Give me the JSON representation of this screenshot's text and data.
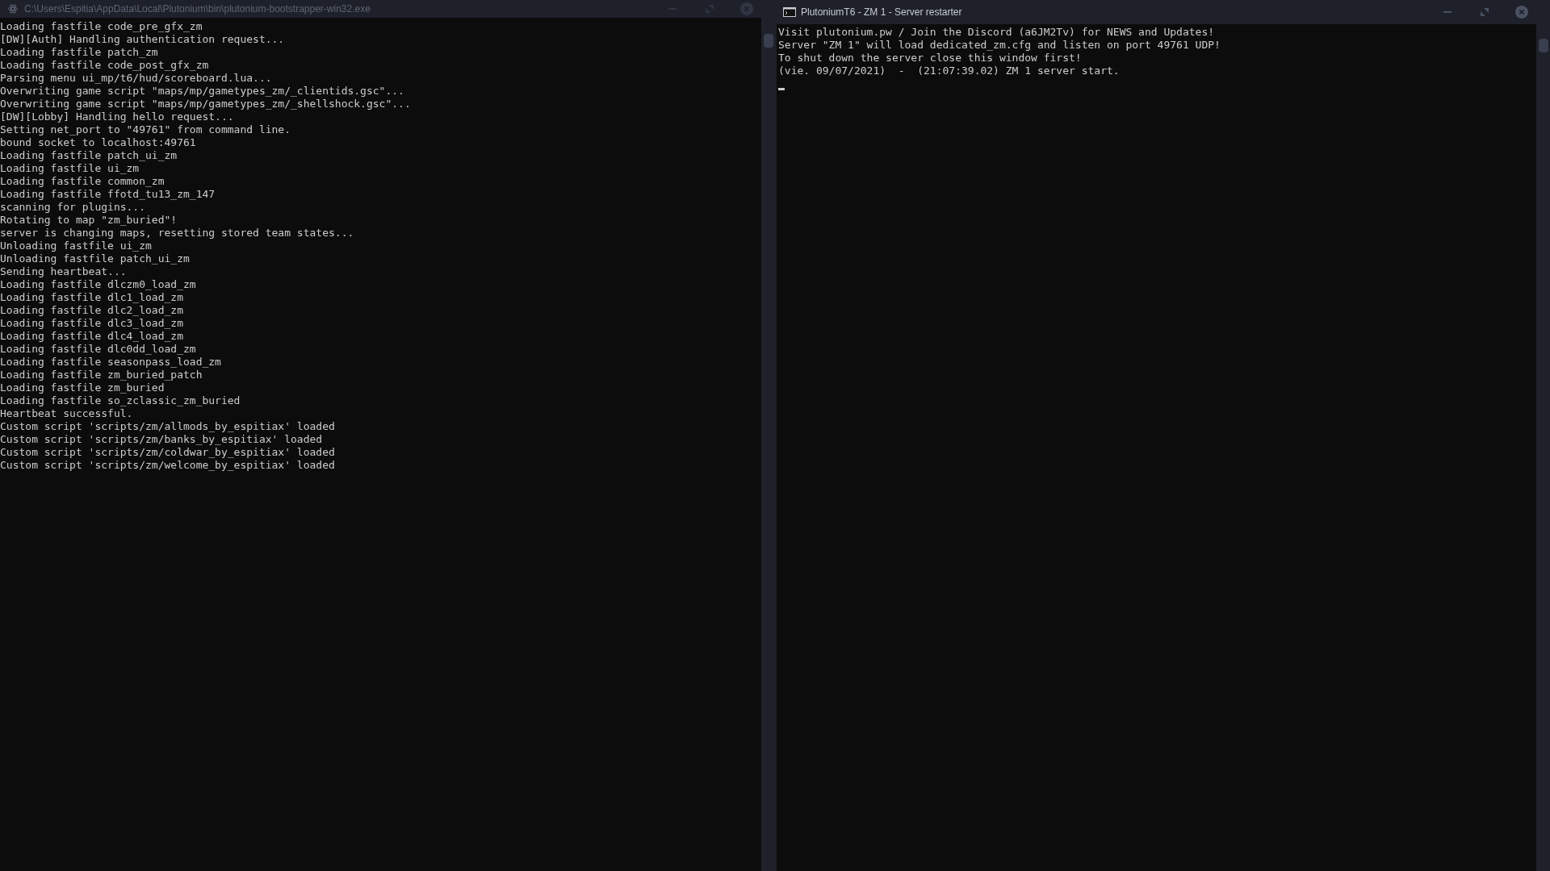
{
  "left_window": {
    "title": "C:\\Users\\Espitia\\AppData\\Local\\Plutonium\\bin\\plutonium-bootstrapper-win32.exe",
    "active": false,
    "lines": [
      "Loading fastfile code_pre_gfx_zm",
      "[DW][Auth] Handling authentication request...",
      "Loading fastfile patch_zm",
      "Loading fastfile code_post_gfx_zm",
      "Parsing menu ui_mp/t6/hud/scoreboard.lua...",
      "Overwriting game script \"maps/mp/gametypes_zm/_clientids.gsc\"...",
      "Overwriting game script \"maps/mp/gametypes_zm/_shellshock.gsc\"...",
      "[DW][Lobby] Handling hello request...",
      "Setting net_port to \"49761\" from command line.",
      "bound socket to localhost:49761",
      "Loading fastfile patch_ui_zm",
      "Loading fastfile ui_zm",
      "Loading fastfile common_zm",
      "Loading fastfile ffotd_tu13_zm_147",
      "scanning for plugins...",
      "Rotating to map \"zm_buried\"!",
      "server is changing maps, resetting stored team states...",
      "Unloading fastfile ui_zm",
      "Unloading fastfile patch_ui_zm",
      "Sending heartbeat...",
      "Loading fastfile dlczm0_load_zm",
      "Loading fastfile dlc1_load_zm",
      "Loading fastfile dlc2_load_zm",
      "Loading fastfile dlc3_load_zm",
      "Loading fastfile dlc4_load_zm",
      "Loading fastfile dlc0dd_load_zm",
      "Loading fastfile seasonpass_load_zm",
      "Loading fastfile zm_buried_patch",
      "Loading fastfile zm_buried",
      "Loading fastfile so_zclassic_zm_buried",
      "Heartbeat successful.",
      "Custom script 'scripts/zm/allmods_by_espitiax' loaded",
      "Custom script 'scripts/zm/banks_by_espitiax' loaded",
      "Custom script 'scripts/zm/coldwar_by_espitiax' loaded",
      "Custom script 'scripts/zm/welcome_by_espitiax' loaded"
    ]
  },
  "right_window": {
    "title": "PlutoniumT6 - ZM 1 - Server restarter",
    "active": true,
    "lines": [
      "Visit plutonium.pw / Join the Discord (a6JM2Tv) for NEWS and Updates!",
      "Server \"ZM 1\" will load dedicated_zm.cfg and listen on port 49761 UDP!",
      "To shut down the server close this window first!",
      "(vie. 09/07/2021)  -  (21:07:39.02) ZM 1 server start."
    ]
  }
}
